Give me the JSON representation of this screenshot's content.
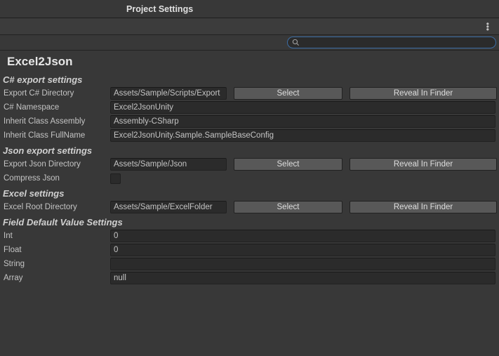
{
  "window": {
    "title": "Project Settings"
  },
  "search": {
    "value": ""
  },
  "page": {
    "title": "Excel2Json"
  },
  "sections": {
    "csharp": {
      "header": "C# export settings",
      "exportDir": {
        "label": "Export C# Directory",
        "value": "Assets/Sample/Scripts/Export",
        "select": "Select",
        "reveal": "Reveal In Finder"
      },
      "namespace": {
        "label": "C# Namespace",
        "value": "Excel2JsonUnity"
      },
      "inheritAssembly": {
        "label": "Inherit Class Assembly",
        "value": "Assembly-CSharp"
      },
      "inheritFullName": {
        "label": "Inherit Class FullName",
        "value": "Excel2JsonUnity.Sample.SampleBaseConfig"
      }
    },
    "json": {
      "header": "Json export settings",
      "exportDir": {
        "label": "Export Json Directory",
        "value": "Assets/Sample/Json",
        "select": "Select",
        "reveal": "Reveal In Finder"
      },
      "compress": {
        "label": "Compress Json",
        "checked": false
      }
    },
    "excel": {
      "header": "Excel settings",
      "rootDir": {
        "label": "Excel Root Directory",
        "value": "Assets/Sample/ExcelFolder",
        "select": "Select",
        "reveal": "Reveal In Finder"
      }
    },
    "defaults": {
      "header": "Field Default Value Settings",
      "int": {
        "label": "Int",
        "value": "0"
      },
      "float": {
        "label": "Float",
        "value": "0"
      },
      "string": {
        "label": "String",
        "value": ""
      },
      "array": {
        "label": "Array",
        "value": "null"
      }
    }
  }
}
